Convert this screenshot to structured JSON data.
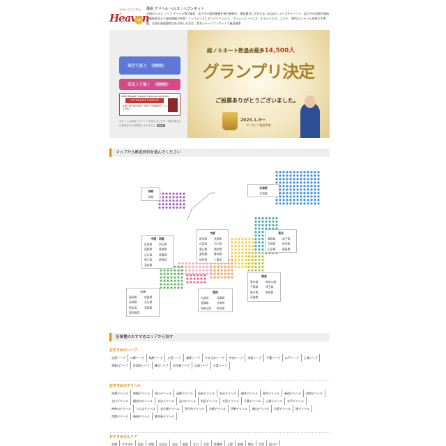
{
  "header": {
    "logo_small": "シティヘブンネット",
    "logo_main": "Heaven",
    "logo_badge": ".net",
    "title": "風俗 デリヘル ヘルス｜ヘブンネット",
    "description": "全国のヘルス ソープ デリヘル等の風俗・女の子の風俗情報を毎日更新中。風俗選びに欠かせないお店のニュースやイベント、女の子の出勤や風俗の最新状況まで風俗情報が充実！ソープランドにデリバリーヘルス、ファッションヘルス、ホテルヘルス、エステ、SMなどジャンルを問わず掲載。全国の風俗優良店をお探しの方は、是非シティヘブンネットで風俗検索"
  },
  "hero": {
    "btn_play": "風俗で遊ぶ",
    "btn_work": "高収入で働く",
    "enter": "ENTER",
    "ad_top": "JAPAN Biggest Foreigner Welcome Listing Site",
    "ad_title": "CITYHEAVEN TRAVELER",
    "ad_body": "外国人旅行者の皆様へ 世界一の風俗旅行へ ようこそ日本へ",
    "note": "当サイトは風俗コンテンツを含んでいます 18歳未満または高校生の方は閲覧になれません",
    "note_exit": "EXIT",
    "banner_line1": "総ノミネート数過去最多",
    "banner_count": "14,500人",
    "banner_title": "グランプリ決定",
    "banner_thanks": "ご投票ありがとうございました。",
    "banner_date": "2023.1.3〜",
    "banner_archive": "アーカイブ配信予定"
  },
  "map_section": {
    "heading": "マップから都道府県を選んでください",
    "regions": [
      {
        "name": "沖縄",
        "prefs": [
          "沖縄"
        ]
      },
      {
        "name": "北海道",
        "prefs": [
          "北海道"
        ]
      },
      {
        "name": "中部",
        "prefs": [
          "新潟県",
          "長野県",
          "山梨県",
          "石川県",
          "富山県",
          "福井県",
          "愛知県",
          "静岡県",
          "岐阜県",
          "三重県"
        ]
      },
      {
        "name": "東北",
        "prefs": [
          "青森県",
          "岩手県",
          "宮城県",
          "秋田県",
          "山形県",
          "福島県"
        ]
      },
      {
        "name": "中国・四国",
        "prefs": [
          "広島県",
          "岡山県",
          "島根県",
          "島根県",
          "山口県",
          "愛媛県",
          "香川県",
          "徳島県",
          "高知県"
        ]
      },
      {
        "name": "関東",
        "prefs": [
          "東京都",
          "神奈川県",
          "千葉県",
          "埼玉県",
          "栃木県",
          "群馬県",
          "茨城県"
        ]
      },
      {
        "name": "九州",
        "prefs": [
          "福岡県",
          "佐賀県",
          "長崎県",
          "大分県",
          "熊本県",
          "宮崎県",
          "鹿児島県"
        ]
      },
      {
        "name": "関西",
        "prefs": [
          "大阪府",
          "兵庫県",
          "滋賀県",
          "京都府",
          "和歌山県",
          "奈良県"
        ]
      }
    ]
  },
  "recommend_section": {
    "heading": "各業種のおすすめエリアから探す",
    "categories": [
      {
        "title": "おすすめのソープ",
        "links": [
          "吉原ソープ",
          "川崎ソープ",
          "福原ソープ",
          "大宮ソープ",
          "雄琴ソープ",
          "すすきのソープ",
          "中洲ソープ",
          "池袋ソープ",
          "千葉ソープ",
          "水戸ソープ",
          "土浦ソープ",
          "和歌山ソープ",
          "金津園ソープ",
          "横浜ソープ",
          "名古屋ソープ",
          "広島ソープ",
          "小倉ソープ"
        ]
      },
      {
        "title": "おすすめのデリヘル",
        "links": [
          "札幌デリヘル",
          "釧路デリヘル",
          "旭川デリヘル",
          "函館デリヘル",
          "仙台デリヘル",
          "金沢デリヘル",
          "福井デリヘル",
          "東京デリヘル",
          "新宿デリヘル",
          "池袋デリヘル",
          "立川デリヘル",
          "錦糸町デリヘル",
          "渋谷デリヘル",
          "品川デリヘル",
          "町田デリヘル",
          "大宮デリヘル",
          "千葉デリヘル",
          "土浦デリヘル",
          "水戸デリヘル",
          "神奈川デリヘル",
          "つくばデリヘル",
          "名古屋デリヘル",
          "四日市デリヘル",
          "京都デリヘル",
          "伊勢デリヘル",
          "亀山デリヘル",
          "大阪デリヘル",
          "堺デリヘル",
          "京都デリヘル",
          "福岡デリヘル",
          "鹿児島デリヘル"
        ]
      },
      {
        "title": "おすすめのエリア",
        "links": [
          "札幌",
          "すすきの",
          "仙台",
          "池袋",
          "五反田",
          "渋谷",
          "新宿",
          "立川",
          "大宮",
          "秋葉原",
          "上野",
          "新橋",
          "熊谷",
          "大宮",
          "西川口"
        ]
      }
    ]
  }
}
